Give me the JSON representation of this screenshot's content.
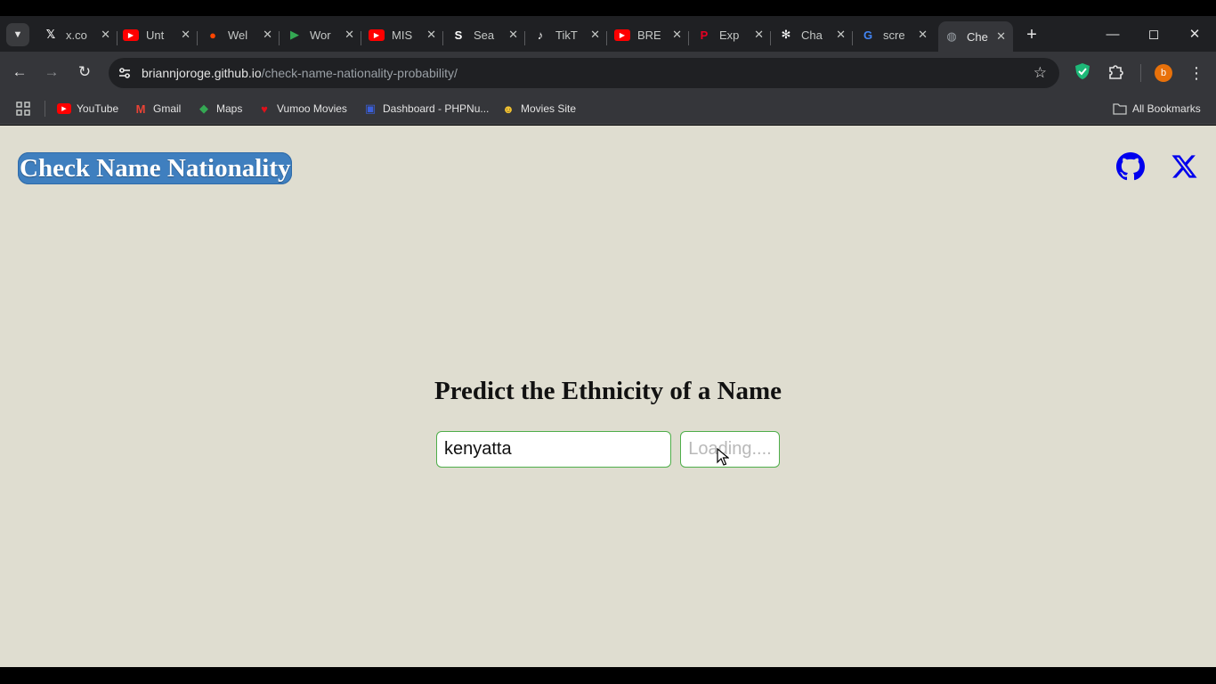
{
  "browser": {
    "tabs": [
      {
        "title": "x.co",
        "icon": "x-logo-icon",
        "color": "#ffffff"
      },
      {
        "title": "Unt",
        "icon": "youtube-icon",
        "color": "#ff0000"
      },
      {
        "title": "Wel",
        "icon": "reddit-icon",
        "color": "#ff4500"
      },
      {
        "title": "Wor",
        "icon": "play-store-icon",
        "color": "#34a853"
      },
      {
        "title": "MIS",
        "icon": "youtube-icon",
        "color": "#ff0000"
      },
      {
        "title": "Sea",
        "icon": "s-logo-icon",
        "color": "#ffffff"
      },
      {
        "title": "TikT",
        "icon": "tiktok-icon",
        "color": "#ffffff"
      },
      {
        "title": "BRE",
        "icon": "youtube-icon",
        "color": "#ff0000"
      },
      {
        "title": "Exp",
        "icon": "pinterest-icon",
        "color": "#e60023"
      },
      {
        "title": "Cha",
        "icon": "chatgpt-icon",
        "color": "#ffffff"
      },
      {
        "title": "scre",
        "icon": "google-icon",
        "color": "#4285f4"
      },
      {
        "title": "Che",
        "icon": "globe-icon",
        "color": "#9aa0a6",
        "active": true
      }
    ],
    "url_host": "briannjoroge.github.io",
    "url_path": "/check-name-nationality-probability/",
    "avatar_letter": "b",
    "bookmarks": [
      {
        "label": "YouTube",
        "icon": "youtube-icon",
        "color": "#ff0000"
      },
      {
        "label": "Gmail",
        "icon": "gmail-icon",
        "color": "#ea4335"
      },
      {
        "label": "Maps",
        "icon": "maps-icon",
        "color": "#34a853"
      },
      {
        "label": "Vumoo Movies",
        "icon": "vumoo-heart-icon",
        "color": "#e0111b"
      },
      {
        "label": "Dashboard - PHPNu...",
        "icon": "dashboard-icon",
        "color": "#3b5fd9"
      },
      {
        "label": "Movies Site",
        "icon": "movies-site-icon",
        "color": "#f2c230"
      }
    ],
    "all_bookmarks_label": "All Bookmarks"
  },
  "page": {
    "brand": "Check Name Nationality",
    "heading": "Predict the Ethnicity of a Name",
    "name_input_value": "kenyatta",
    "submit_label": "Loading....",
    "colors": {
      "background": "#dfddd0",
      "brand_bg": "#3f7fbf",
      "border_green": "#4fae4a",
      "icon_blue": "#0000ee"
    }
  }
}
